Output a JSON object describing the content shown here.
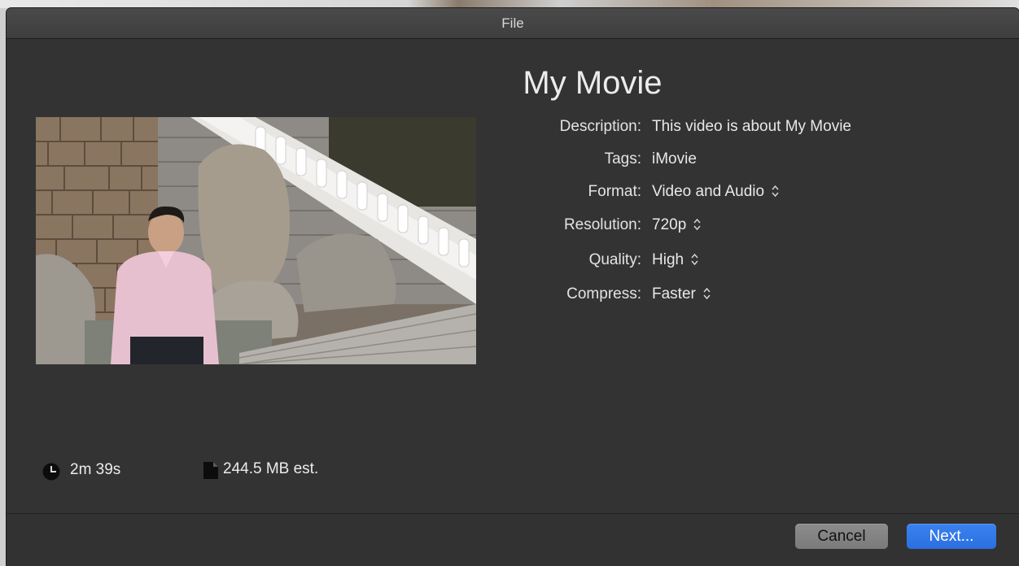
{
  "window": {
    "title": "File"
  },
  "project": {
    "name": "My Movie"
  },
  "details": [
    {
      "key": "description",
      "label": "Description:",
      "value": "This video is about My Movie",
      "popup": false
    },
    {
      "key": "tags",
      "label": "Tags:",
      "value": "iMovie",
      "popup": false
    },
    {
      "key": "format",
      "label": "Format:",
      "value": "Video and Audio",
      "popup": true
    },
    {
      "key": "resolution",
      "label": "Resolution:",
      "value": "720p",
      "popup": true
    },
    {
      "key": "quality",
      "label": "Quality:",
      "value": "High",
      "popup": true
    },
    {
      "key": "compress",
      "label": "Compress:",
      "value": "Faster",
      "popup": true
    }
  ],
  "footer": {
    "duration": "2m 39s",
    "file_size": "244.5 MB est."
  },
  "buttons": {
    "cancel": "Cancel",
    "next": "Next..."
  },
  "icons": {
    "duration": "clock-icon",
    "file_size": "document-icon",
    "popup": "chevron-updown-icon"
  },
  "colors": {
    "sheet_bg": "#333333",
    "primary_button": "#2b6fe0",
    "secondary_button": "#7b7b7b"
  }
}
